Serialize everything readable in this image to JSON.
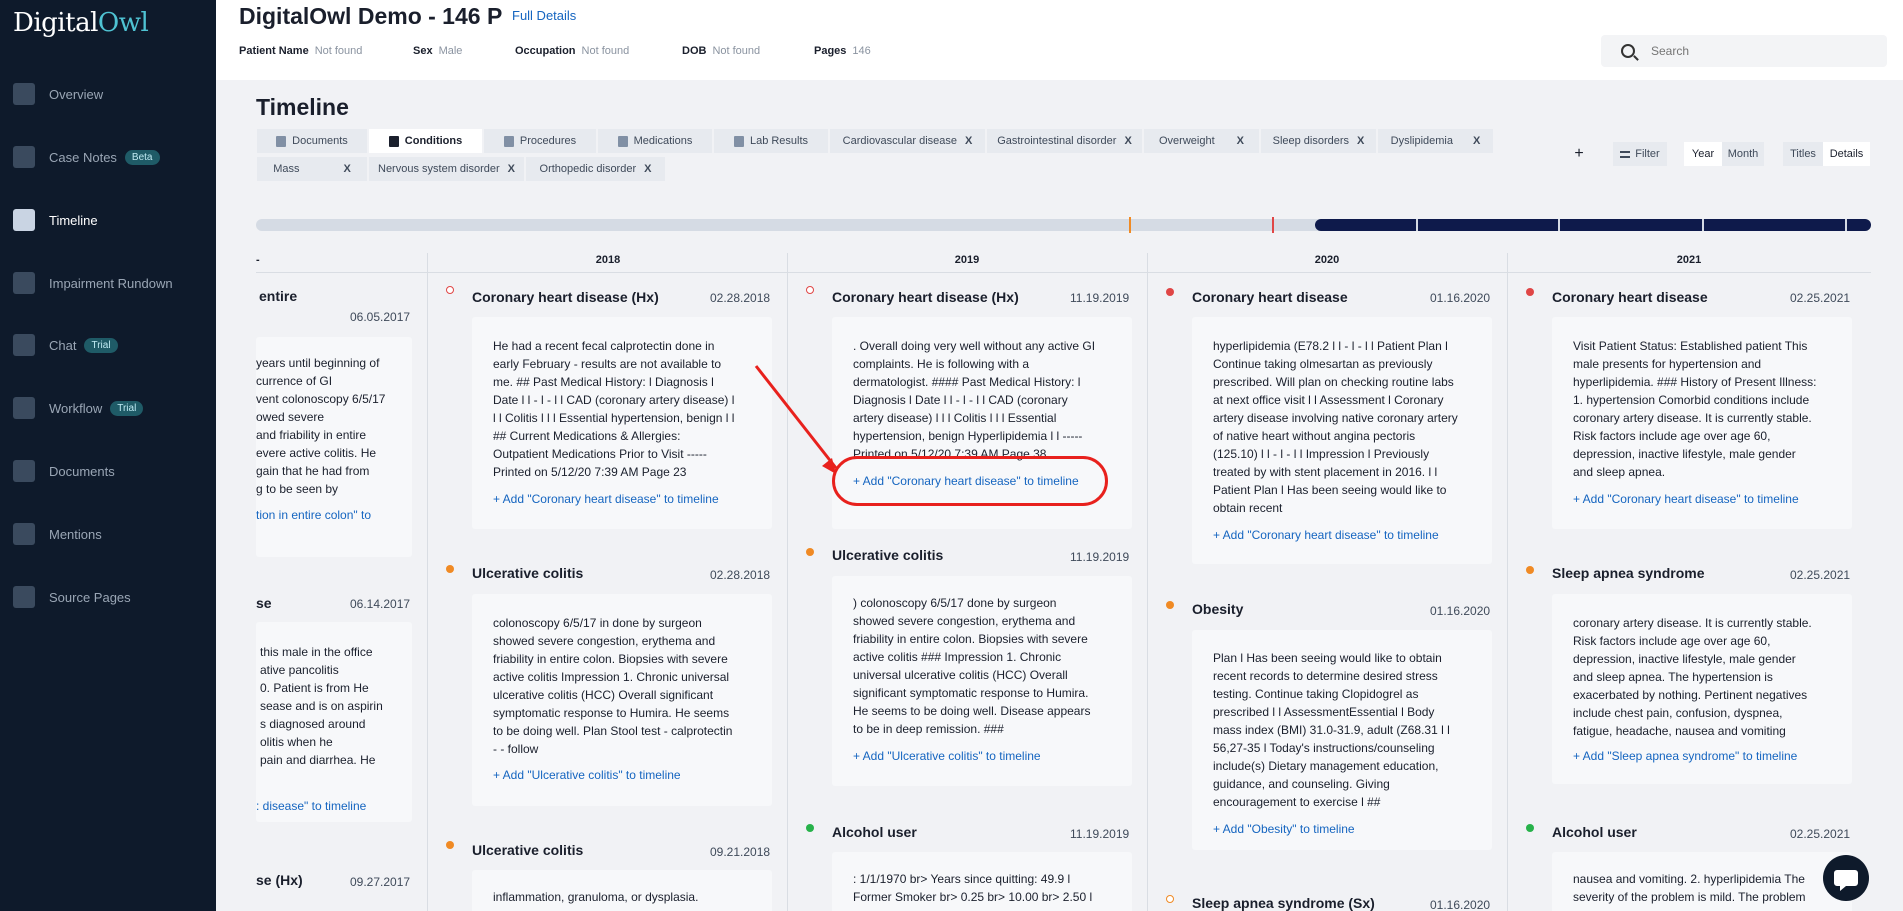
{
  "brand": {
    "name_a": "Digital",
    "name_b": "Owl"
  },
  "sidebar": {
    "items": [
      {
        "label": "Overview"
      },
      {
        "label": "Case Notes",
        "badge": "Beta"
      },
      {
        "label": "Timeline"
      },
      {
        "label": "Impairment Rundown"
      },
      {
        "label": "Chat",
        "badge": "Trial"
      },
      {
        "label": "Workflow",
        "badge": "Trial"
      },
      {
        "label": "Documents"
      },
      {
        "label": "Mentions"
      },
      {
        "label": "Source Pages"
      }
    ]
  },
  "header": {
    "title": "DigitalOwl Demo - 146 P",
    "full_details": "Full Details",
    "patient_name_label": "Patient Name",
    "patient_name": "Not found",
    "sex_label": "Sex",
    "sex": "Male",
    "occupation_label": "Occupation",
    "occupation": "Not found",
    "dob_label": "DOB",
    "dob": "Not found",
    "pages_label": "Pages",
    "pages": "146",
    "search_placeholder": "Search"
  },
  "timeline": {
    "title": "Timeline",
    "tabs": [
      "Documents",
      "Conditions",
      "Procedures",
      "Medications",
      "Lab Results"
    ],
    "filters": [
      "Cardiovascular disease",
      "Gastrointestinal disorder",
      "Overweight",
      "Sleep disorders",
      "Dyslipidemia",
      "Mass",
      "Nervous system disorder",
      "Orthopedic disorder"
    ],
    "filter_x": "X",
    "plus": "+",
    "filter": "Filter",
    "year": "Year",
    "month": "Month",
    "titles": "Titles",
    "details": "Details",
    "range_fraction": 0.34,
    "years": [
      "2018",
      "2019",
      "2020",
      "2021"
    ],
    "col0_mark": "-"
  },
  "columns": {
    "c0": {
      "e1": {
        "title": "entire",
        "date": "06.05.2017",
        "lines": [
          "years until beginning of",
          "currence of GI",
          "vent colonoscopy 6/5/17",
          "owed severe",
          "and friability in entire",
          "evere active colitis. He",
          "gain that he had from",
          "g to be seen by"
        ],
        "link": "tion in entire colon\" to"
      },
      "e2": {
        "title": "se",
        "date": "06.14.2017",
        "lines": [
          "this male in the office",
          "ative pancolitis",
          "0. Patient is from He",
          "sease and is on aspirin",
          "s diagnosed around",
          "olitis when he",
          "pain and diarrhea. He"
        ],
        "link": ": disease\" to timeline"
      },
      "e3": {
        "title": "se (Hx)",
        "date": "09.27.2017"
      }
    },
    "c1": {
      "e1": {
        "title": "Coronary heart disease (Hx)",
        "date": "02.28.2018",
        "lines": [
          "He had a recent fecal calprotectin done in",
          "early February - results are not available to",
          "me. ## Past Medical History: l Diagnosis l",
          "Date l l - l - l l CAD (coronary artery disease) l",
          "l l Colitis l l l Essential hypertension, benign l l",
          "## Current Medications & Allergies:",
          "Outpatient Medications Prior to Visit -----",
          "Printed on 5/12/20 7:39 AM Page 23"
        ],
        "link": "+ Add \"Coronary heart disease\" to timeline"
      },
      "e2": {
        "title": "Ulcerative colitis",
        "date": "02.28.2018",
        "lines": [
          "colonoscopy 6/5/17 in done by surgeon",
          "showed severe congestion, erythema and",
          "friability in entire colon. Biopsies with severe",
          "active colitis Impression 1. Chronic universal",
          "ulcerative colitis (HCC) Overall significant",
          "symptomatic response to Humira. He seems",
          "to be doing well. Plan Stool test - calprotectin",
          "- - follow"
        ],
        "link": "+ Add \"Ulcerative colitis\" to timeline"
      },
      "e3": {
        "title": "Ulcerative colitis",
        "date": "09.21.2018",
        "lines": [
          "inflammation, granuloma, or dysplasia."
        ]
      }
    },
    "c2": {
      "e1": {
        "title": "Coronary heart disease (Hx)",
        "date": "11.19.2019",
        "lines": [
          ". Overall doing very well without any active GI",
          "complaints. He is following with a",
          "dermatologist. #### Past Medical History: l",
          "Diagnosis l Date l l - l - l l CAD (coronary",
          "artery disease) l l l Colitis l l l Essential",
          "hypertension, benign Hyperlipidemia l l -----",
          "Printed on 5/12/20 7:39 AM Page 38"
        ],
        "link": "+ Add \"Coronary heart disease\" to timeline"
      },
      "e2": {
        "title": "Ulcerative colitis",
        "date": "11.19.2019",
        "lines": [
          ") colonoscopy 6/5/17 done by surgeon",
          "showed severe congestion, erythema and",
          "friability in entire colon. Biopsies with severe",
          "active colitis ### Impression 1. Chronic",
          "universal ulcerative colitis (HCC) Overall",
          "significant symptomatic response to Humira.",
          "He seems to be doing well. Disease appears",
          "to be in deep remission. ###"
        ],
        "link": "+ Add \"Ulcerative colitis\" to timeline"
      },
      "e3": {
        "title": "Alcohol user",
        "date": "11.19.2019",
        "lines": [
          ": 1/1/1970 br> Years since quitting: 49.9 l",
          "Former Smoker br> 0.25 br> 10.00 br> 2.50 l"
        ]
      }
    },
    "c3": {
      "e1": {
        "title": "Coronary heart disease",
        "date": "01.16.2020",
        "lines": [
          "hyperlipidemia (E78.2 l l - l - l l Patient Plan l",
          "Continue taking olmesartan as previously",
          "prescribed. Will plan on checking routine labs",
          "at next office visit l l Assessment l Coronary",
          "artery disease involving native coronary artery",
          "of native heart without angina pectoris",
          "(125.10) l l - l - l l Impression l Previously",
          "treated by with stent placement in 2016. l l",
          "Patient Plan l Has been seeing would like to",
          "obtain recent"
        ],
        "link": "+ Add \"Coronary heart disease\" to timeline"
      },
      "e2": {
        "title": "Obesity",
        "date": "01.16.2020",
        "lines": [
          "Plan l Has been seeing would like to obtain",
          "recent records to determine desired stress",
          "testing. Continue taking Clopidogrel as",
          "prescribed l l AssessmentEssential l Body",
          "mass index (BMI) 31.0-31.9, adult (Z68.31 l l",
          "56,27-35 l Today's instructions/counseling",
          "include(s) Dietary management education,",
          "guidance, and counseling. Giving",
          "encouragement to exercise l ##"
        ],
        "link": "+ Add \"Obesity\" to timeline"
      },
      "e3": {
        "title": "Sleep apnea syndrome (Sx)",
        "date": "01.16.2020"
      }
    },
    "c4": {
      "e1": {
        "title": "Coronary heart disease",
        "date": "02.25.2021",
        "lines": [
          "Visit Patient Status: Established patient This",
          "male presents for hypertension and",
          "hyperlipidemia. ### History of Present Illness:",
          "1. hypertension Comorbid conditions include",
          "coronary artery disease. It is currently stable.",
          "Risk factors include age over age 60,",
          "depression, inactive lifestyle, male gender",
          "and sleep apnea."
        ],
        "link": "+ Add \"Coronary heart disease\" to timeline"
      },
      "e2": {
        "title": "Sleep apnea syndrome",
        "date": "02.25.2021",
        "lines": [
          "coronary artery disease. It is currently stable.",
          "Risk factors include age over age 60,",
          "depression, inactive lifestyle, male gender",
          "and sleep apnea. The hypertension is",
          "exacerbated by nothing. Pertinent negatives",
          "include chest pain, confusion, dyspnea,",
          "fatigue, headache, nausea and vomiting"
        ],
        "link": "+ Add \"Sleep apnea syndrome\" to timeline"
      },
      "e3": {
        "title": "Alcohol user",
        "date": "02.25.2021",
        "lines": [
          "nausea and vomiting. 2. hyperlipidemia The",
          "severity of the problem is mild. The problem"
        ]
      }
    }
  },
  "colors": {
    "sidebar": "#0e1a2b",
    "accent": "#4fc3d3",
    "link": "#1565c0",
    "highlight": "#e8211d",
    "dot_red": "#e04646",
    "dot_orange": "#f08a24",
    "dot_green": "#27b24a"
  }
}
